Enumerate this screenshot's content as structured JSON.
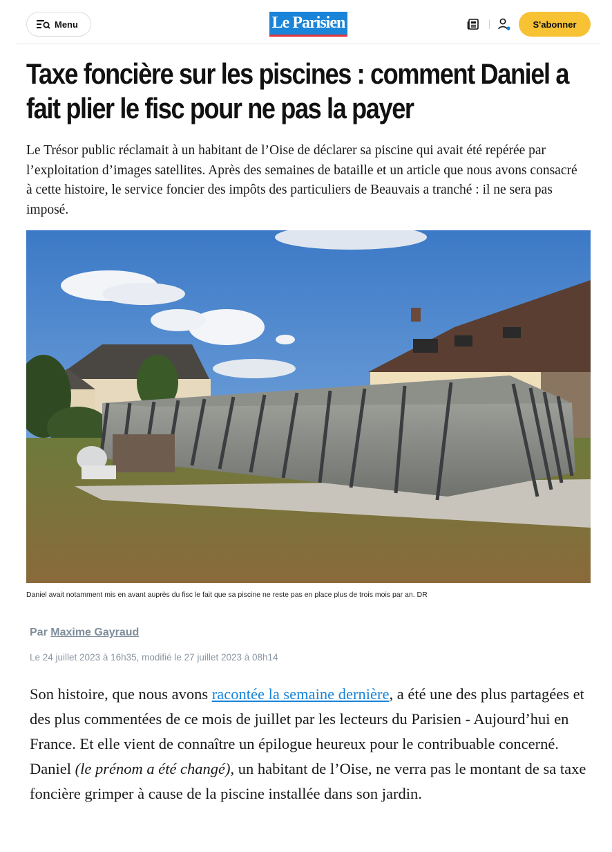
{
  "header": {
    "menu_label": "Menu",
    "logo_text": "Le Parisien",
    "subscribe_label": "S'abonner"
  },
  "article": {
    "title": "Taxe foncière sur les piscines : comment Daniel a fait plier le fisc pour ne pas la payer",
    "lead": "Le Trésor public réclamait à un habitant de l’Oise de déclarer sa piscine qui avait été repérée par l’exploitation d’images satellites. Après des semaines de bataille et un article que nous avons consacré à cette histoire, le service foncier des impôts des particuliers de Beauvais a tranché : il ne sera pas imposé.",
    "caption": "Daniel avait notamment mis en avant auprès du fisc le fait que sa piscine ne reste pas en place plus de trois mois par an. DR",
    "byline_prefix": "Par",
    "author": "Maxime Gayraud",
    "dateline": "Le 24 juillet 2023 à 16h35, modifié le 27 juillet 2023 à 08h14",
    "body_part1": "Son histoire, que nous avons ",
    "body_link": "racontée la semaine dernière",
    "body_part2": ", a été une des plus partagées et des plus commentées de ce mois de juillet par les lecteurs du Parisien - Aujourd’hui en France. Et elle vient de connaître un épilogue heureux pour le contribuable concerné. Daniel ",
    "body_italic": "(le prénom a été changé)",
    "body_part3": ", un habitant de l’Oise, ne verra pas le montant de sa taxe foncière grimper à cause de la piscine installée dans son jardin."
  },
  "colors": {
    "brand_blue": "#1a84d8",
    "brand_red": "#e4353b",
    "subscribe_yellow": "#f7c233",
    "byline_gray": "#7f8d9a"
  },
  "icons": [
    "menu-search-icon",
    "newspaper-icon",
    "user-icon"
  ]
}
